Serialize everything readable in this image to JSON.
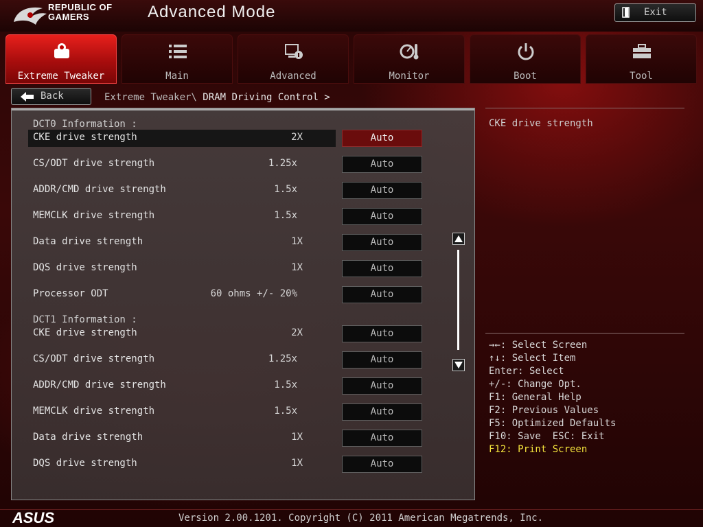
{
  "header": {
    "brand_line1": "REPUBLIC OF",
    "brand_line2": "GAMERS",
    "title": "Advanced Mode",
    "exit_label": "Exit"
  },
  "tabs": [
    {
      "label": "Extreme Tweaker",
      "icon": "tweaker-icon",
      "active": true
    },
    {
      "label": "Main",
      "icon": "list-icon",
      "active": false
    },
    {
      "label": "Advanced",
      "icon": "advanced-settings-icon",
      "active": false
    },
    {
      "label": "Monitor",
      "icon": "monitor-gauge-icon",
      "active": false
    },
    {
      "label": "Boot",
      "icon": "power-icon",
      "active": false
    },
    {
      "label": "Tool",
      "icon": "toolbox-icon",
      "active": false
    }
  ],
  "nav": {
    "back_label": "Back",
    "breadcrumb_parent": "Extreme Tweaker\\",
    "breadcrumb_current": "DRAM Driving Control >"
  },
  "main": {
    "dct0_header": "DCT0 Information :",
    "dct1_header": "DCT1 Information :",
    "dct0": [
      {
        "label": "CKE drive strength",
        "value": "2X",
        "option": "Auto"
      },
      {
        "label": "CS/ODT drive strength",
        "value": "1.25x",
        "option": "Auto"
      },
      {
        "label": "ADDR/CMD drive strength",
        "value": "1.5x",
        "option": "Auto"
      },
      {
        "label": "MEMCLK drive strength",
        "value": "1.5x",
        "option": "Auto"
      },
      {
        "label": "Data drive strength",
        "value": "1X",
        "option": "Auto"
      },
      {
        "label": "DQS drive strength",
        "value": "1X",
        "option": "Auto"
      },
      {
        "label": "Processor ODT",
        "value": "60 ohms +/- 20%",
        "option": "Auto"
      }
    ],
    "dct1": [
      {
        "label": "CKE drive strength",
        "value": "2X",
        "option": "Auto"
      },
      {
        "label": "CS/ODT drive strength",
        "value": "1.25x",
        "option": "Auto"
      },
      {
        "label": "ADDR/CMD drive strength",
        "value": "1.5x",
        "option": "Auto"
      },
      {
        "label": "MEMCLK drive strength",
        "value": "1.5x",
        "option": "Auto"
      },
      {
        "label": "Data drive strength",
        "value": "1X",
        "option": "Auto"
      },
      {
        "label": "DQS drive strength",
        "value": "1X",
        "option": "Auto"
      }
    ]
  },
  "help": {
    "description": "CKE drive strength",
    "keys": [
      "→←: Select Screen",
      "↑↓: Select Item",
      "Enter: Select",
      "+/-: Change Opt.",
      "F1: General Help",
      "F2: Previous Values",
      "F5: Optimized Defaults",
      "F10: Save  ESC: Exit"
    ],
    "print_key": "F12: Print Screen"
  },
  "footer": {
    "version": "Version 2.00.1201. Copyright (C) 2011 American Megatrends, Inc.",
    "logo_text": "ASUS"
  },
  "colors": {
    "accent_red": "#e8201c",
    "selected_option": "#6a0c0c",
    "print_key": "#f2e23c"
  }
}
